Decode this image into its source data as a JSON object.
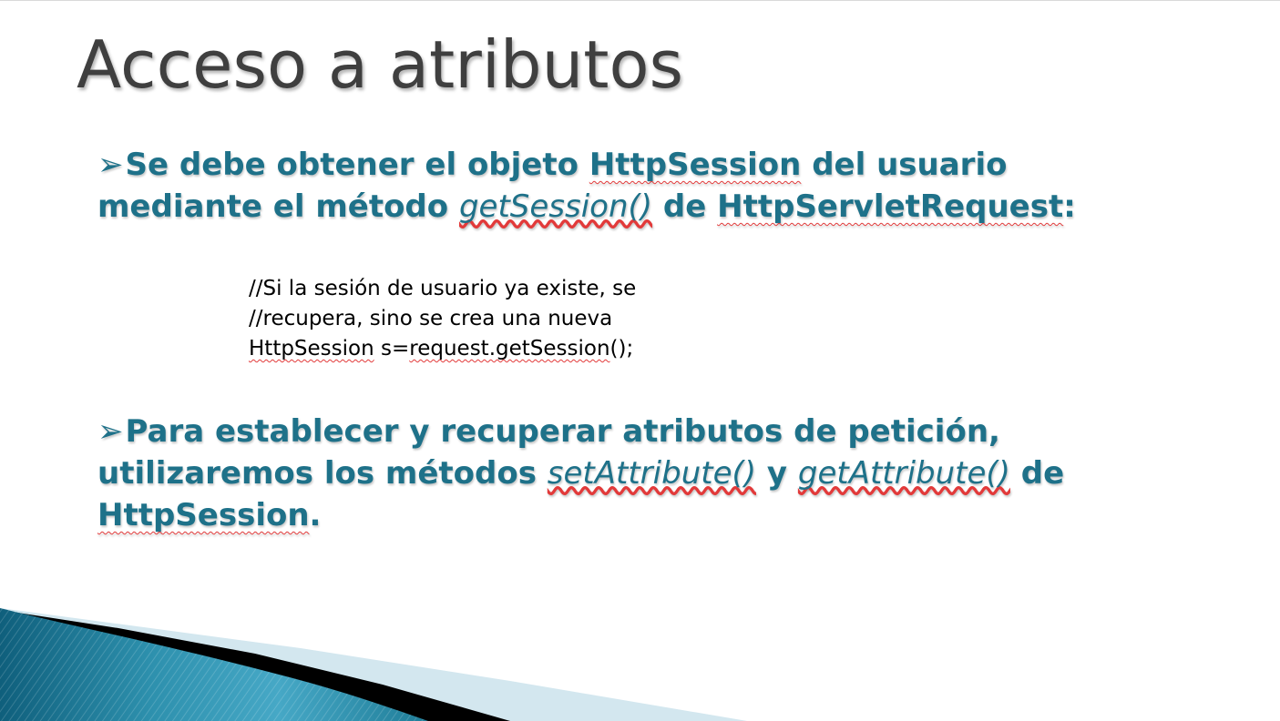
{
  "slide": {
    "title": "Acceso a atributos",
    "bullet_marker": "➢",
    "bullet1": {
      "t1": "Se debe obtener el objeto ",
      "t2": "HttpSession",
      "t3": " del usuario mediante el método ",
      "t4": "getSession()",
      "t5": " de ",
      "t6": "HttpServletRequest",
      "t7": ":"
    },
    "code": {
      "line1": "//Si la sesión de usuario ya existe, se",
      "line2": "//recupera, sino se crea una nueva",
      "line3_a": "HttpSession",
      "line3_b": " s=",
      "line3_c": "request.getSession",
      "line3_d": "();"
    },
    "bullet2": {
      "t1": "Para establecer y recuperar atributos de petición, utilizaremos los métodos ",
      "t2": "setAttribute()",
      "t3": " y ",
      "t4": "getAttribute()",
      "t5": " de ",
      "t6": "HttpSession",
      "t7": "."
    }
  },
  "colors": {
    "title": "#3f3f3f",
    "bullet_text": "#1e7189",
    "spellcheck": "#e23a3a",
    "decor_teal": "#1a7a97",
    "decor_light": "#d3e7ef",
    "decor_black": "#000000"
  }
}
